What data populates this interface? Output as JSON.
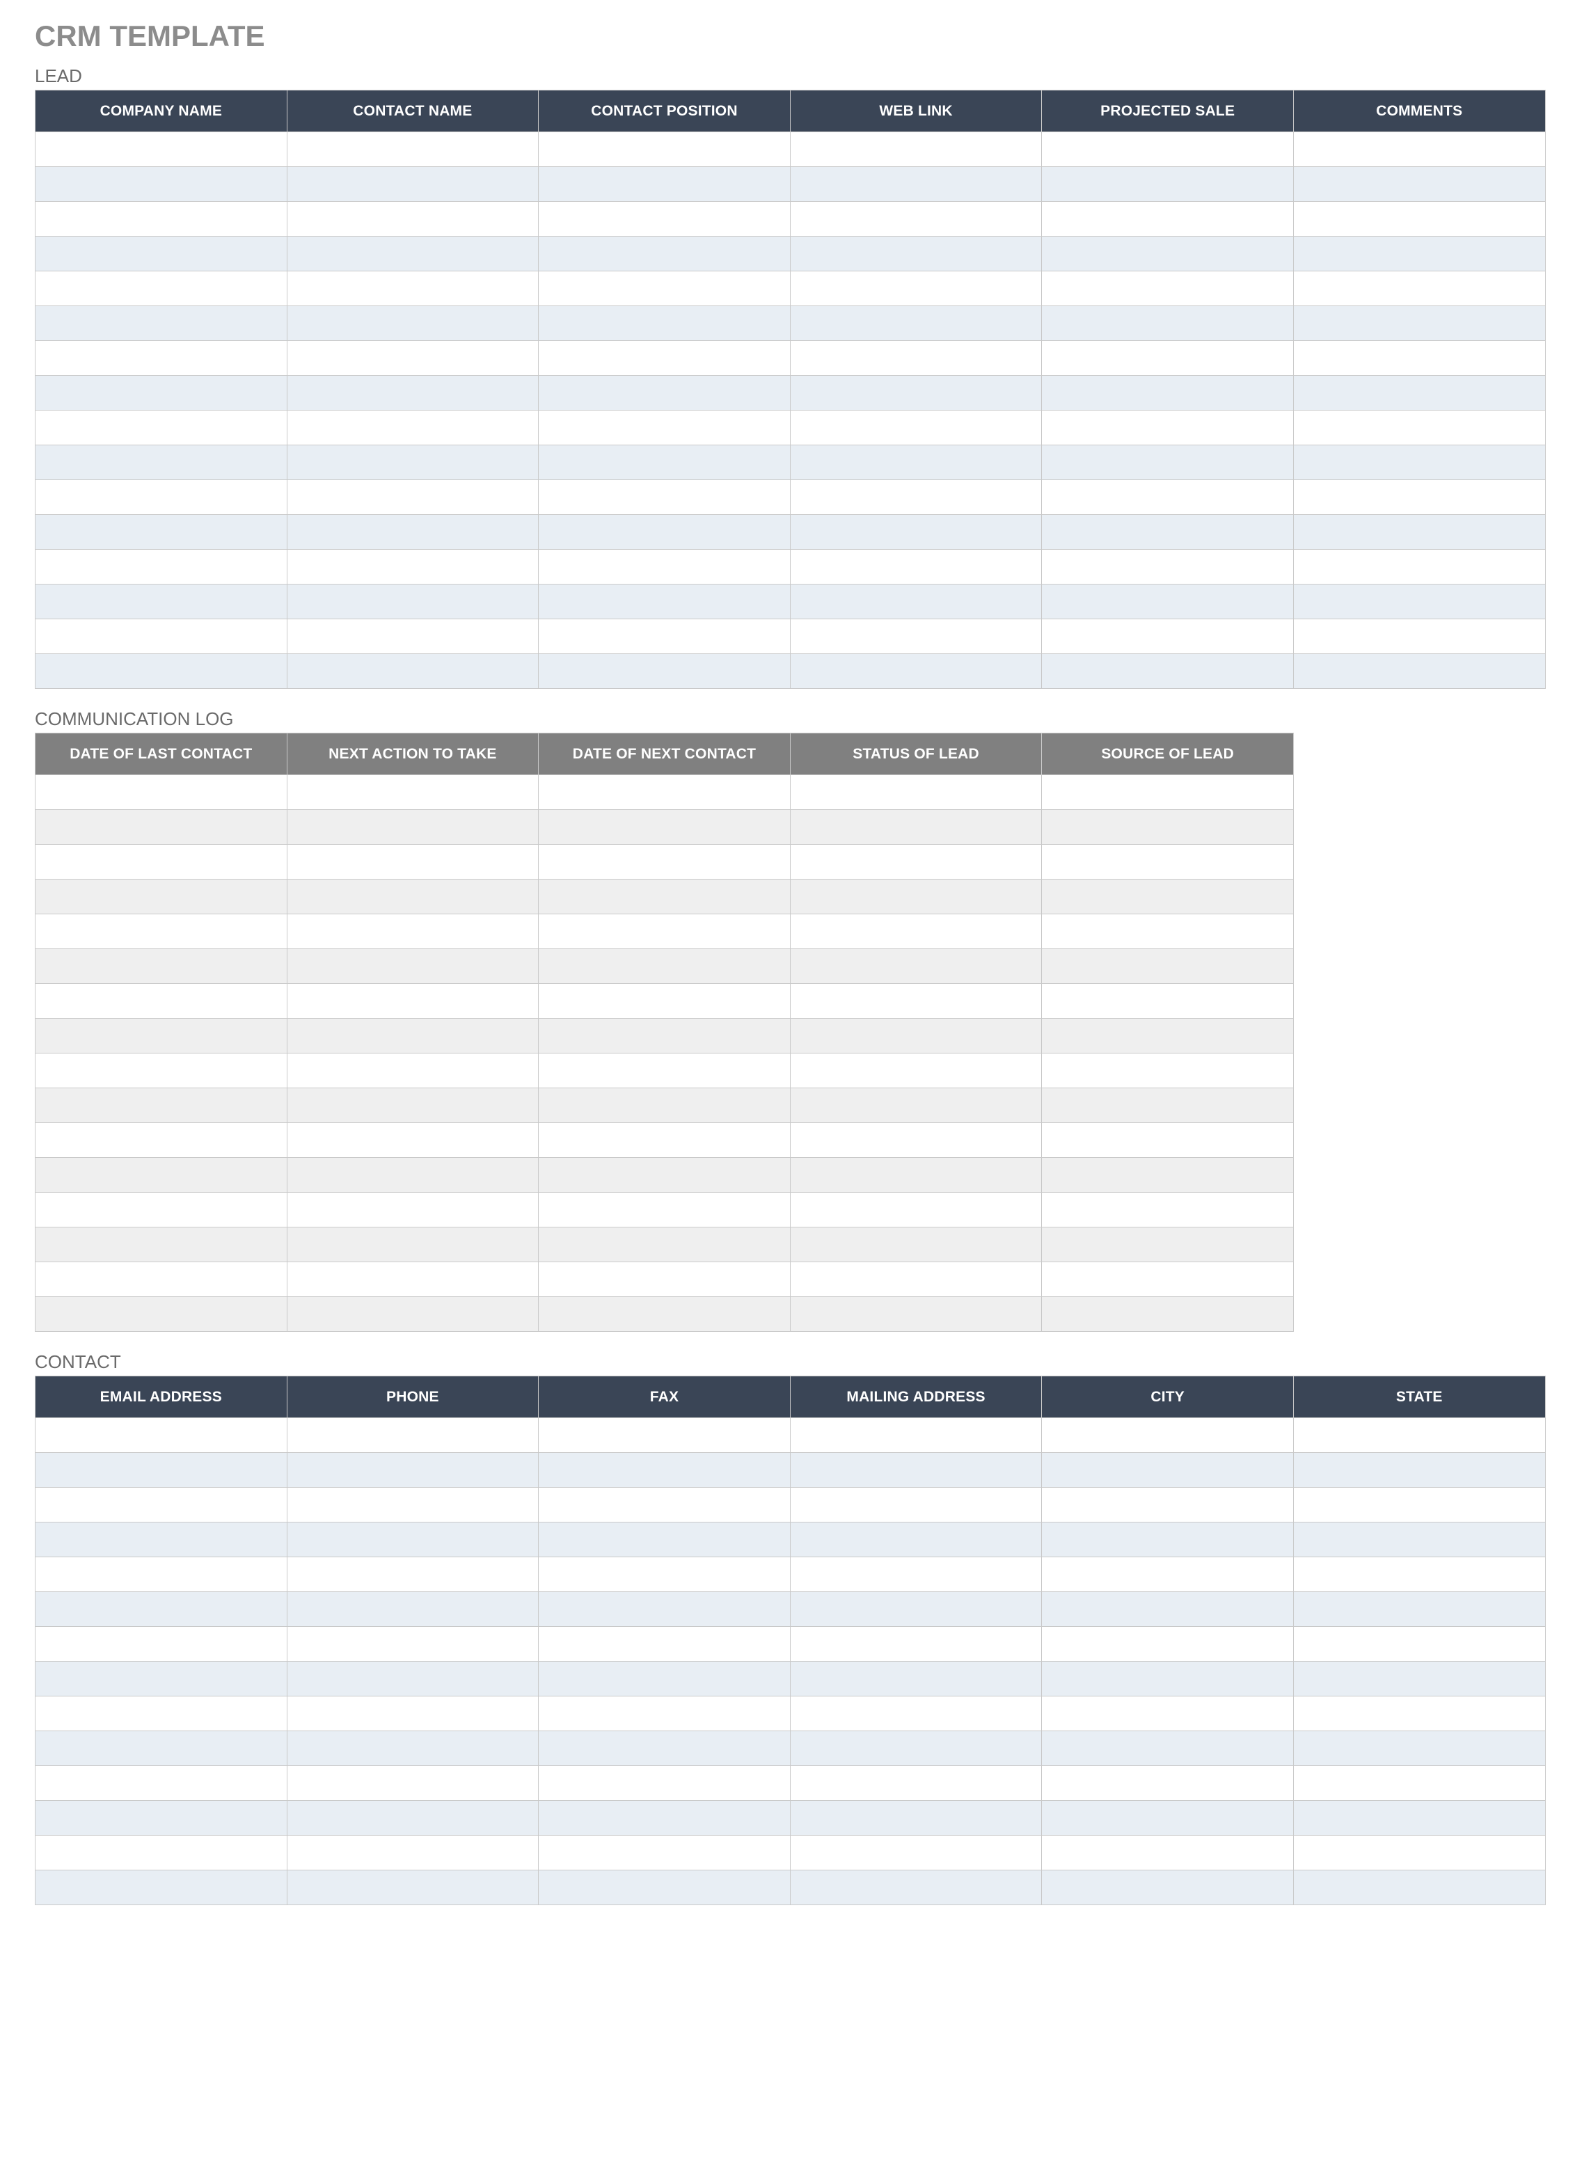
{
  "title": "CRM TEMPLATE",
  "sections": {
    "lead": {
      "label": "LEAD",
      "headers": [
        "COMPANY NAME",
        "CONTACT NAME",
        "CONTACT POSITION",
        "WEB LINK",
        "PROJECTED SALE",
        "COMMENTS"
      ],
      "header_style": "dark",
      "alt_row_style": "blue",
      "rows": [
        [
          "",
          "",
          "",
          "",
          "",
          ""
        ],
        [
          "",
          "",
          "",
          "",
          "",
          ""
        ],
        [
          "",
          "",
          "",
          "",
          "",
          ""
        ],
        [
          "",
          "",
          "",
          "",
          "",
          ""
        ],
        [
          "",
          "",
          "",
          "",
          "",
          ""
        ],
        [
          "",
          "",
          "",
          "",
          "",
          ""
        ],
        [
          "",
          "",
          "",
          "",
          "",
          ""
        ],
        [
          "",
          "",
          "",
          "",
          "",
          ""
        ],
        [
          "",
          "",
          "",
          "",
          "",
          ""
        ],
        [
          "",
          "",
          "",
          "",
          "",
          ""
        ],
        [
          "",
          "",
          "",
          "",
          "",
          ""
        ],
        [
          "",
          "",
          "",
          "",
          "",
          ""
        ],
        [
          "",
          "",
          "",
          "",
          "",
          ""
        ],
        [
          "",
          "",
          "",
          "",
          "",
          ""
        ],
        [
          "",
          "",
          "",
          "",
          "",
          ""
        ],
        [
          "",
          "",
          "",
          "",
          "",
          ""
        ]
      ]
    },
    "log": {
      "label": "COMMUNICATION LOG",
      "headers": [
        "DATE OF LAST CONTACT",
        "NEXT ACTION TO TAKE",
        "DATE OF NEXT CONTACT",
        "STATUS OF LEAD",
        "SOURCE OF LEAD"
      ],
      "header_style": "grey",
      "alt_row_style": "grey",
      "rows": [
        [
          "",
          "",
          "",
          "",
          ""
        ],
        [
          "",
          "",
          "",
          "",
          ""
        ],
        [
          "",
          "",
          "",
          "",
          ""
        ],
        [
          "",
          "",
          "",
          "",
          ""
        ],
        [
          "",
          "",
          "",
          "",
          ""
        ],
        [
          "",
          "",
          "",
          "",
          ""
        ],
        [
          "",
          "",
          "",
          "",
          ""
        ],
        [
          "",
          "",
          "",
          "",
          ""
        ],
        [
          "",
          "",
          "",
          "",
          ""
        ],
        [
          "",
          "",
          "",
          "",
          ""
        ],
        [
          "",
          "",
          "",
          "",
          ""
        ],
        [
          "",
          "",
          "",
          "",
          ""
        ],
        [
          "",
          "",
          "",
          "",
          ""
        ],
        [
          "",
          "",
          "",
          "",
          ""
        ],
        [
          "",
          "",
          "",
          "",
          ""
        ],
        [
          "",
          "",
          "",
          "",
          ""
        ]
      ]
    },
    "contact": {
      "label": "CONTACT",
      "headers": [
        "EMAIL ADDRESS",
        "PHONE",
        "FAX",
        "MAILING ADDRESS",
        "CITY",
        "STATE"
      ],
      "header_style": "dark",
      "alt_row_style": "blue",
      "rows": [
        [
          "",
          "",
          "",
          "",
          "",
          ""
        ],
        [
          "",
          "",
          "",
          "",
          "",
          ""
        ],
        [
          "",
          "",
          "",
          "",
          "",
          ""
        ],
        [
          "",
          "",
          "",
          "",
          "",
          ""
        ],
        [
          "",
          "",
          "",
          "",
          "",
          ""
        ],
        [
          "",
          "",
          "",
          "",
          "",
          ""
        ],
        [
          "",
          "",
          "",
          "",
          "",
          ""
        ],
        [
          "",
          "",
          "",
          "",
          "",
          ""
        ],
        [
          "",
          "",
          "",
          "",
          "",
          ""
        ],
        [
          "",
          "",
          "",
          "",
          "",
          ""
        ],
        [
          "",
          "",
          "",
          "",
          "",
          ""
        ],
        [
          "",
          "",
          "",
          "",
          "",
          ""
        ],
        [
          "",
          "",
          "",
          "",
          "",
          ""
        ],
        [
          "",
          "",
          "",
          "",
          "",
          ""
        ]
      ]
    }
  }
}
